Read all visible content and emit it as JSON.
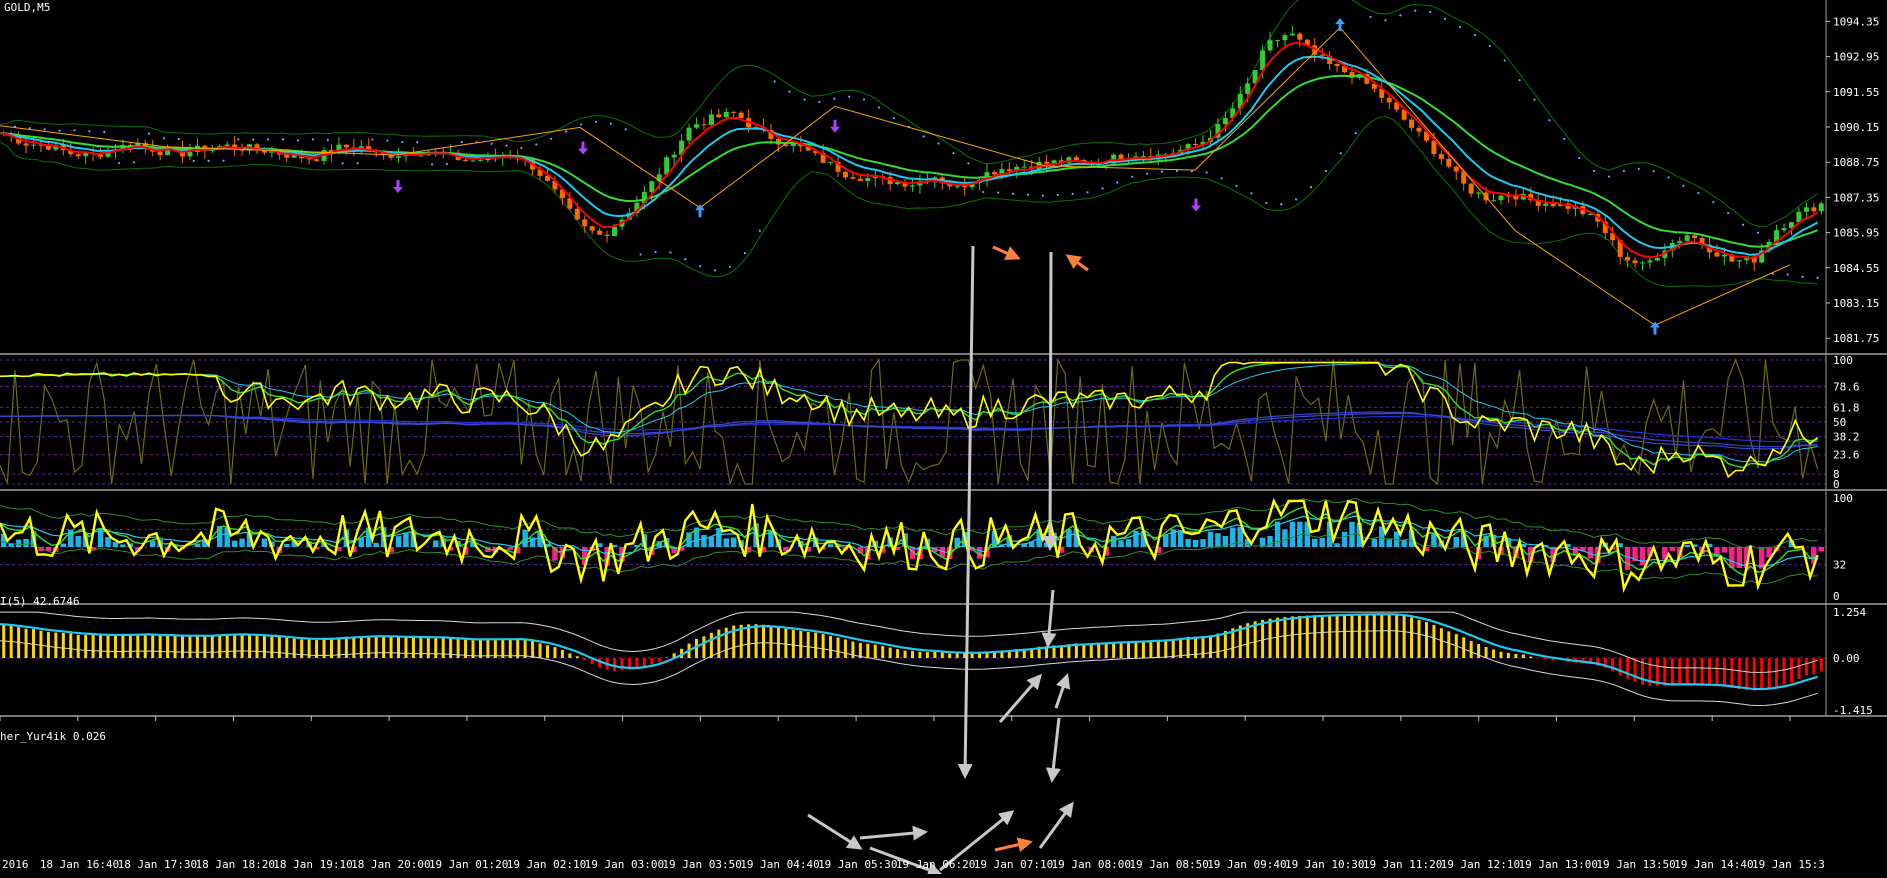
{
  "window": {
    "symbol_label": "GOLD,M5"
  },
  "colors": {
    "background": "#000000",
    "grid": "#808080",
    "bull": "#32cd32",
    "bear": "#ff6a00",
    "ma_red": "#ff0000",
    "ma_blue": "#1ec8f0",
    "ma_green": "#32dc32",
    "bollinger": "#0b6f0b",
    "psar": "#6fa8ff",
    "zigzag": "#ffa500",
    "fractal_up": "#3a9cff",
    "fractal_down": "#b040ff",
    "yellow_line": "#ffff00",
    "hist_pos": "#ffd700",
    "hist_neg": "#ff0000",
    "osc_pos": "#1eb4e6",
    "osc_neg": "#ff1e8c",
    "arrow_grey": "#c8c8c8",
    "arrow_orange": "#ff7f3f"
  },
  "price_axis": {
    "labels": [
      "1094.35",
      "1092.95",
      "1091.55",
      "1090.15",
      "1088.75",
      "1087.35",
      "1085.95",
      "1084.55",
      "1083.15",
      "1081.75"
    ]
  },
  "stoch_panel": {
    "labels": [
      "100",
      "78.6",
      "61.8",
      "50",
      "38.2",
      "23.6",
      "8",
      "0"
    ]
  },
  "rsi_panel": {
    "title": "I(5) 42.6746",
    "labels": [
      "100",
      "32",
      "0"
    ]
  },
  "fisher_panel": {
    "title": "her_Yur4ik 0.026",
    "labels": [
      "1.254",
      "0.00",
      "-1.415"
    ]
  },
  "time_axis": {
    "labels": [
      "2016",
      "18 Jan 16:40",
      "18 Jan 17:30",
      "18 Jan 18:20",
      "18 Jan 19:10",
      "18 Jan 20:00",
      "19 Jan 01:20",
      "19 Jan 02:10",
      "19 Jan 03:00",
      "19 Jan 03:50",
      "19 Jan 04:40",
      "19 Jan 05:30",
      "19 Jan 06:20",
      "19 Jan 07:10",
      "19 Jan 08:00",
      "19 Jan 08:50",
      "19 Jan 09:40",
      "19 Jan 10:30",
      "19 Jan 11:20",
      "19 Jan 12:10",
      "19 Jan 13:00",
      "19 Jan 13:50",
      "19 Jan 14:40",
      "19 Jan 15:3"
    ]
  },
  "chart_data": {
    "type": "candlestick",
    "title": "GOLD,M5",
    "ylim": [
      1081.2,
      1095.2
    ],
    "close_path": [
      1089.9,
      1089.5,
      1089.4,
      1089.1,
      1089.0,
      1089.3,
      1089.5,
      1089.2,
      1089.1,
      1089.3,
      1089.4,
      1089.3,
      1089.2,
      1089.0,
      1088.9,
      1089.3,
      1089.4,
      1089.0,
      1089.1,
      1089.2,
      1089.0,
      1088.8,
      1088.9,
      1089.1,
      1088.5,
      1087.4,
      1086.2,
      1085.8,
      1086.6,
      1087.6,
      1088.9,
      1090.2,
      1090.5,
      1090.7,
      1090.0,
      1089.6,
      1089.3,
      1088.8,
      1088.3,
      1088.1,
      1088.0,
      1087.9,
      1088.2,
      1087.7,
      1088.2,
      1088.5,
      1088.6,
      1088.7,
      1088.8,
      1088.7,
      1088.9,
      1089.1,
      1089.0,
      1089.2,
      1089.5,
      1090.3,
      1091.6,
      1093.4,
      1093.9,
      1093.1,
      1092.5,
      1092.2,
      1091.5,
      1090.6,
      1089.7,
      1088.8,
      1087.7,
      1087.3,
      1087.5,
      1087.2,
      1087.1,
      1086.9,
      1086.3,
      1085.0,
      1084.6,
      1085.4,
      1085.9,
      1085.3,
      1084.8,
      1084.9,
      1086.1,
      1086.7,
      1087.1
    ]
  }
}
